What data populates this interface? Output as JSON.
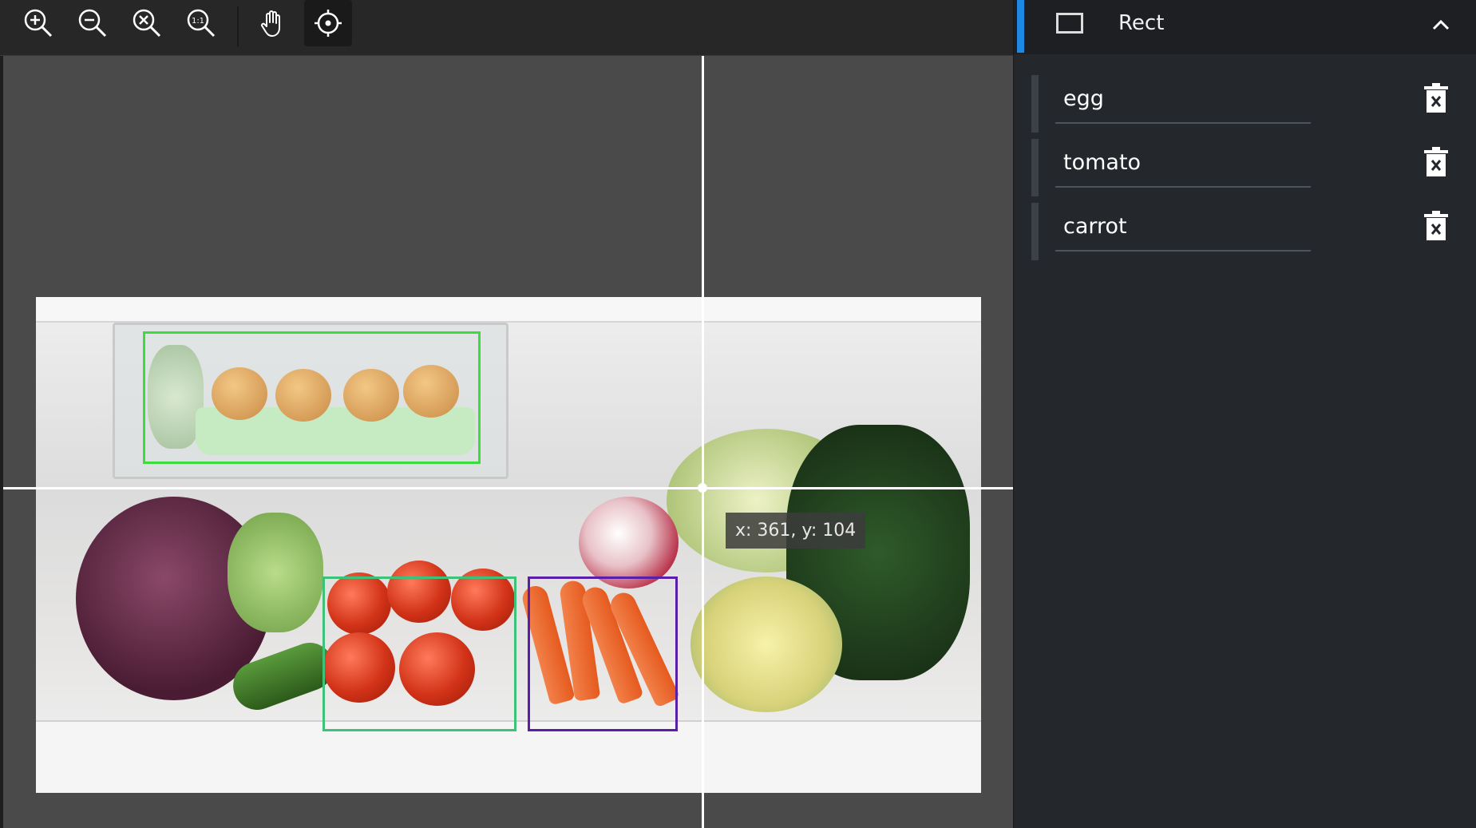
{
  "toolbar": {
    "tools": [
      {
        "name": "zoom-in-icon"
      },
      {
        "name": "zoom-out-icon"
      },
      {
        "name": "zoom-fit-icon"
      },
      {
        "name": "zoom-actual-size-icon",
        "label": "1:1"
      },
      {
        "name": "pan-hand-icon"
      },
      {
        "name": "crosshair-target-icon",
        "active": true
      }
    ]
  },
  "canvas": {
    "coordinate_readout": "x: 361, y: 104",
    "annotations": [
      {
        "label": "egg",
        "color": "#3ddc3d"
      },
      {
        "label": "tomato",
        "color": "#3ec27a"
      },
      {
        "label": "carrot",
        "color": "#5a1fa8"
      }
    ]
  },
  "panel": {
    "title": "Rect",
    "accent_color": "#1e88e5",
    "labels": [
      {
        "text": "egg"
      },
      {
        "text": "tomato"
      },
      {
        "text": "carrot"
      }
    ]
  }
}
